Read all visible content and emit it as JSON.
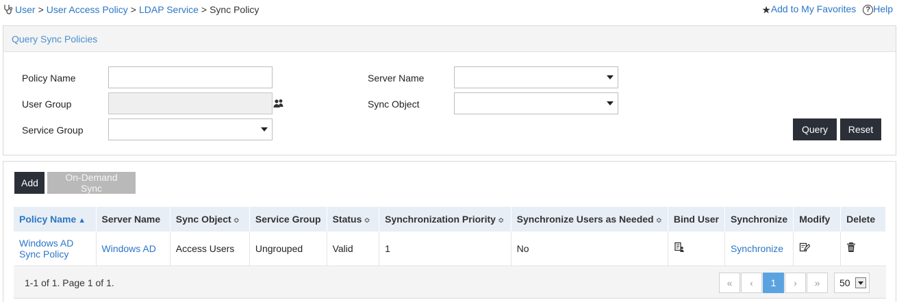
{
  "breadcrumb": {
    "items": [
      "User",
      "User Access Policy",
      "LDAP Service"
    ],
    "current": "Sync Policy"
  },
  "topright": {
    "favorites": "Add to My Favorites",
    "help": "Help"
  },
  "query": {
    "title": "Query Sync Policies",
    "policy_name_label": "Policy Name",
    "user_group_label": "User Group",
    "service_group_label": "Service Group",
    "server_name_label": "Server Name",
    "sync_object_label": "Sync Object",
    "query_button": "Query",
    "reset_button": "Reset"
  },
  "list": {
    "add_button": "Add",
    "ondemand_button": "On-Demand Sync",
    "columns": [
      "Policy Name",
      "Server Name",
      "Sync Object",
      "Service Group",
      "Status",
      "Synchronization Priority",
      "Synchronize Users as Needed",
      "Bind User",
      "Synchronize",
      "Modify",
      "Delete"
    ],
    "rows": [
      {
        "policy_name": "Windows AD Sync Policy",
        "server_name": "Windows AD",
        "sync_object": "Access Users",
        "service_group": "Ungrouped",
        "status": "Valid",
        "priority": "1",
        "sync_as_needed": "No",
        "bind_user_icon": "bind-user-icon",
        "synchronize": "Synchronize",
        "modify_icon": "edit-icon",
        "delete_icon": "trash-icon"
      }
    ],
    "pager": {
      "summary": "1-1 of 1. Page 1 of 1.",
      "current_page": "1",
      "first": "«",
      "prev": "‹",
      "next": "›",
      "last": "»",
      "page_size": "50"
    }
  },
  "colors": {
    "link": "#2a76c6",
    "dark_button": "#2b2f38",
    "header_bg": "#e8eef5",
    "active_page": "#5ba3e0"
  }
}
